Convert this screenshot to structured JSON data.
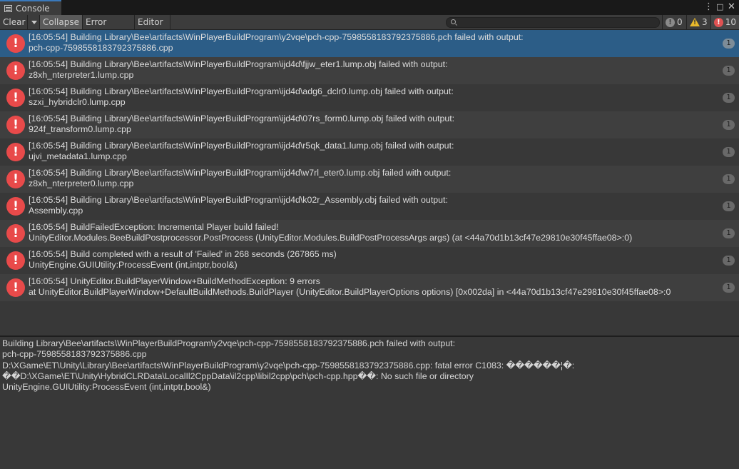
{
  "tab": {
    "title": "Console"
  },
  "window_controls": {
    "menu": "⋮",
    "maximize": "□",
    "close": "✕"
  },
  "toolbar": {
    "clear": "Clear",
    "collapse": "Collapse",
    "error_pause": "Error Pause",
    "editor": "Editor",
    "search_placeholder": "",
    "info_count": "0",
    "warning_count": "3",
    "error_count": "10"
  },
  "logs": [
    {
      "line1": "[16:05:54] Building Library\\Bee\\artifacts\\WinPlayerBuildProgram\\y2vqe\\pch-cpp-7598558183792375886.pch failed with output:",
      "line2": "pch-cpp-7598558183792375886.cpp",
      "count": "1",
      "selected": true
    },
    {
      "line1": "[16:05:54] Building Library\\Bee\\artifacts\\WinPlayerBuildProgram\\ijd4d\\fjjw_eter1.lump.obj failed with output:",
      "line2": "z8xh_nterpreter1.lump.cpp",
      "count": "1"
    },
    {
      "line1": "[16:05:54] Building Library\\Bee\\artifacts\\WinPlayerBuildProgram\\ijd4d\\adg6_dclr0.lump.obj failed with output:",
      "line2": "szxi_hybridclr0.lump.cpp",
      "count": "1"
    },
    {
      "line1": "[16:05:54] Building Library\\Bee\\artifacts\\WinPlayerBuildProgram\\ijd4d\\07rs_form0.lump.obj failed with output:",
      "line2": "924f_transform0.lump.cpp",
      "count": "1"
    },
    {
      "line1": "[16:05:54] Building Library\\Bee\\artifacts\\WinPlayerBuildProgram\\ijd4d\\r5qk_data1.lump.obj failed with output:",
      "line2": "ujvi_metadata1.lump.cpp",
      "count": "1"
    },
    {
      "line1": "[16:05:54] Building Library\\Bee\\artifacts\\WinPlayerBuildProgram\\ijd4d\\w7rl_eter0.lump.obj failed with output:",
      "line2": "z8xh_nterpreter0.lump.cpp",
      "count": "1"
    },
    {
      "line1": "[16:05:54] Building Library\\Bee\\artifacts\\WinPlayerBuildProgram\\ijd4d\\k02r_Assembly.obj failed with output:",
      "line2": "Assembly.cpp",
      "count": "1"
    },
    {
      "line1": "[16:05:54] BuildFailedException: Incremental Player build failed!",
      "line2": "UnityEditor.Modules.BeeBuildPostprocessor.PostProcess (UnityEditor.Modules.BuildPostProcessArgs args) (at <44a70d1b13cf47e29810e30f45ffae08>:0)",
      "count": "1"
    },
    {
      "line1": "[16:05:54] Build completed with a result of 'Failed' in 268 seconds (267865 ms)",
      "line2": "UnityEngine.GUIUtility:ProcessEvent (int,intptr,bool&)",
      "count": "1"
    },
    {
      "line1": "[16:05:54] UnityEditor.BuildPlayerWindow+BuildMethodException: 9 errors",
      "line2": "  at UnityEditor.BuildPlayerWindow+DefaultBuildMethods.BuildPlayer (UnityEditor.BuildPlayerOptions options) [0x002da] in <44a70d1b13cf47e29810e30f45ffae08>:0",
      "count": "1"
    }
  ],
  "detail": {
    "lines": [
      "Building Library\\Bee\\artifacts\\WinPlayerBuildProgram\\y2vqe\\pch-cpp-7598558183792375886.pch failed with output:",
      "pch-cpp-7598558183792375886.cpp",
      "D:\\XGame\\ET\\Unity\\Library\\Bee\\artifacts\\WinPlayerBuildProgram\\y2vqe\\pch-cpp-7598558183792375886.cpp: fatal error C1083: ������¦�:",
      "��D:\\XGame\\ET\\Unity\\HybridCLRData\\LocalIl2CppData\\il2cpp\\libil2cpp\\pch\\pch-cpp.hpp��: No such file or directory",
      "UnityEngine.GUIUtility:ProcessEvent (int,intptr,bool&)"
    ]
  },
  "colors": {
    "selected_row": "#2c5d87",
    "error_red": "#e84a4a",
    "warning_yellow": "#e8b92b",
    "tab_accent": "#3a79bb"
  },
  "icons": {
    "tab": "console-icon",
    "search": "search-icon",
    "info": "info-icon",
    "warning": "warning-icon",
    "error": "error-icon"
  }
}
